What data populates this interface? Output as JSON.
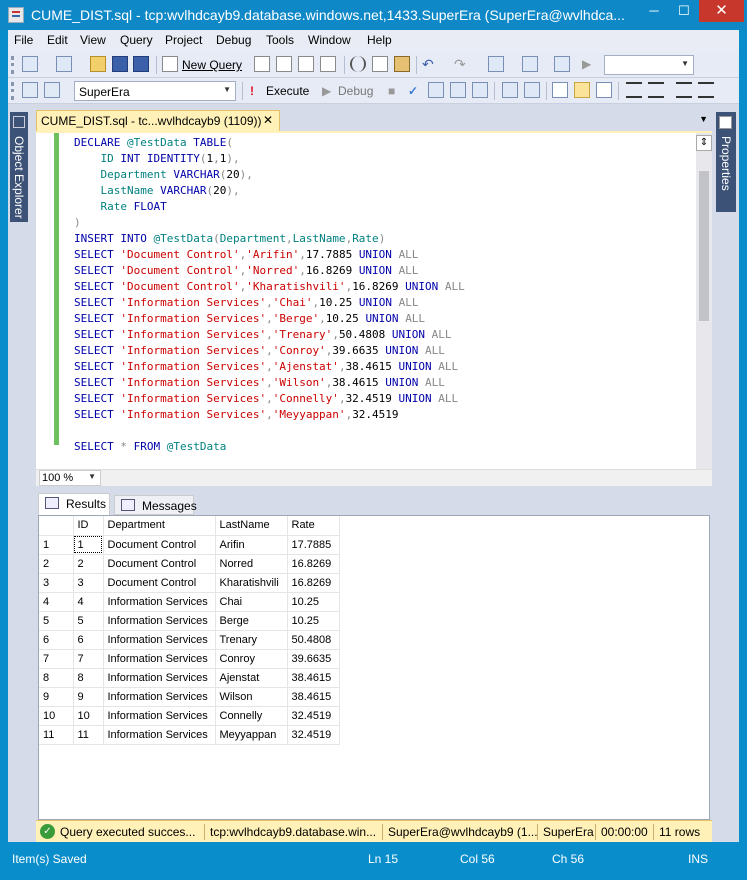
{
  "window": {
    "title": "CUME_DIST.sql - tcp:wvlhdcayb9.database.windows.net,1433.SuperEra (SuperEra@wvlhdca...",
    "minimize": "─",
    "maximize": "☐",
    "close": "✕"
  },
  "menu": [
    "File",
    "Edit",
    "View",
    "Query",
    "Project",
    "Debug",
    "Tools",
    "Window",
    "Help"
  ],
  "toolbar": {
    "new_query": "New Query",
    "database": "SuperEra",
    "execute": "Execute",
    "debug": "Debug"
  },
  "sidebars": {
    "left": "Object Explorer",
    "right": "Properties"
  },
  "document_tab": {
    "label": "CUME_DIST.sql - tc...wvlhdcayb9 (1109))",
    "close": "✕"
  },
  "editor": {
    "zoom": "100 %"
  },
  "results_tabs": {
    "results": "Results",
    "messages": "Messages"
  },
  "grid": {
    "columns": [
      "ID",
      "Department",
      "LastName",
      "Rate"
    ],
    "rows": [
      [
        "1",
        "1",
        "Document Control",
        "Arifin",
        "17.7885"
      ],
      [
        "2",
        "2",
        "Document Control",
        "Norred",
        "16.8269"
      ],
      [
        "3",
        "3",
        "Document Control",
        "Kharatishvili",
        "16.8269"
      ],
      [
        "4",
        "4",
        "Information Services",
        "Chai",
        "10.25"
      ],
      [
        "5",
        "5",
        "Information Services",
        "Berge",
        "10.25"
      ],
      [
        "6",
        "6",
        "Information Services",
        "Trenary",
        "50.4808"
      ],
      [
        "7",
        "7",
        "Information Services",
        "Conroy",
        "39.6635"
      ],
      [
        "8",
        "8",
        "Information Services",
        "Ajenstat",
        "38.4615"
      ],
      [
        "9",
        "9",
        "Information Services",
        "Wilson",
        "38.4615"
      ],
      [
        "10",
        "10",
        "Information Services",
        "Connelly",
        "32.4519"
      ],
      [
        "11",
        "11",
        "Information Services",
        "Meyyappan",
        "32.4519"
      ]
    ]
  },
  "query_status": {
    "message": "Query executed succes...",
    "server": "tcp:wvlhdcayb9.database.win...",
    "login": "SuperEra@wvlhdcayb9 (1...",
    "database": "SuperEra",
    "elapsed": "00:00:00",
    "rows": "11 rows"
  },
  "statusbar": {
    "state": "Item(s) Saved",
    "line": "Ln 15",
    "col": "Col 56",
    "ch": "Ch 56",
    "mode": "INS"
  }
}
